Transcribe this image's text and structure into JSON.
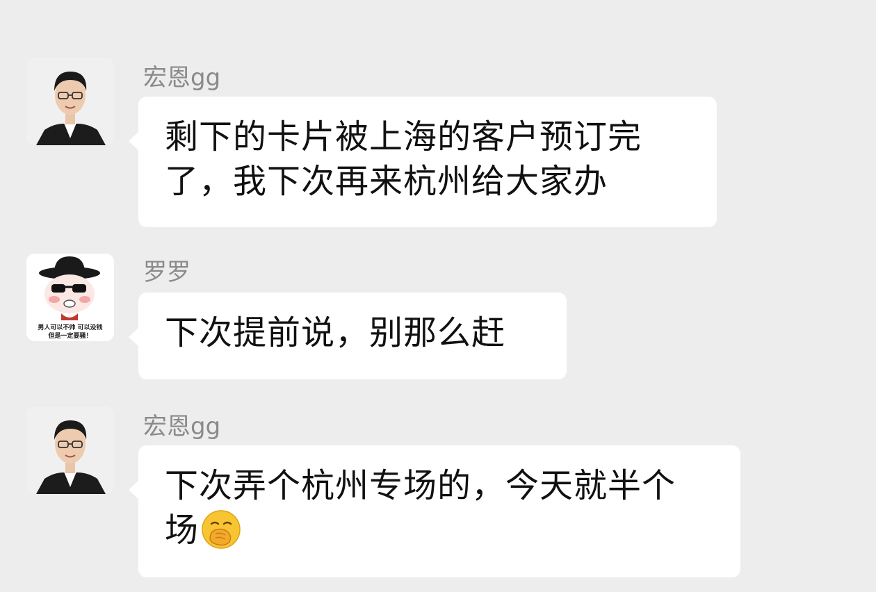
{
  "messages": [
    {
      "sender": "宏恩gg",
      "avatar": "portrait-avatar",
      "lines": [
        "剩下的卡片被上海的客户预订完",
        "了，我下次再来杭州给大家办"
      ]
    },
    {
      "sender": "罗罗",
      "avatar": "cartoon-hat-avatar",
      "avatar_caption": [
        "男人可以不帅 可以没钱",
        "但是一定要骚！"
      ],
      "lines": [
        "下次提前说，别那么赶"
      ]
    },
    {
      "sender": "宏恩gg",
      "avatar": "portrait-avatar",
      "lines": [
        "下次弄个杭州专场的，今天就半个",
        "场"
      ],
      "trailing_emoji": "hand-over-mouth-emoji"
    }
  ],
  "colors": {
    "background": "#ededed",
    "bubble": "#ffffff",
    "sender_name": "#8a8a8a",
    "text": "#111111"
  }
}
